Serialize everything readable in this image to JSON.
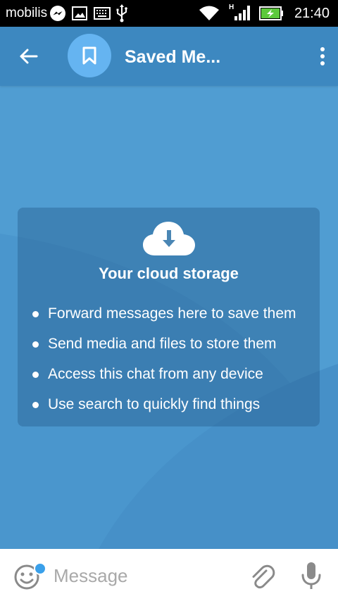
{
  "status_bar": {
    "carrier": "mobilis",
    "time": "21:40",
    "network_type": "H",
    "icons": [
      "messenger-icon",
      "gallery-icon",
      "keyboard-icon",
      "usb-icon",
      "wifi-icon",
      "signal-icon",
      "battery-charging-icon"
    ]
  },
  "app_bar": {
    "title": "Saved Me...",
    "avatar_icon": "bookmark-icon",
    "back_icon": "arrow-left-icon",
    "menu_icon": "more-vertical-icon"
  },
  "empty_state": {
    "icon": "cloud-download-icon",
    "title": "Your cloud storage",
    "items": [
      "Forward messages here to save them",
      "Send media and files to store them",
      "Access this chat from any device",
      "Use search to quickly find things"
    ]
  },
  "composer": {
    "placeholder": "Message",
    "emoji_icon": "emoji-icon",
    "attach_icon": "paperclip-icon",
    "mic_icon": "microphone-icon"
  },
  "colors": {
    "status_bar": "#000000",
    "app_bar": "#3d88c0",
    "chat_background": "#4f9bd0",
    "avatar": "#65b4f1",
    "composer_background": "#ffffff",
    "placeholder_text": "#a9a9a9",
    "notification_dot": "#3aa0ea"
  }
}
